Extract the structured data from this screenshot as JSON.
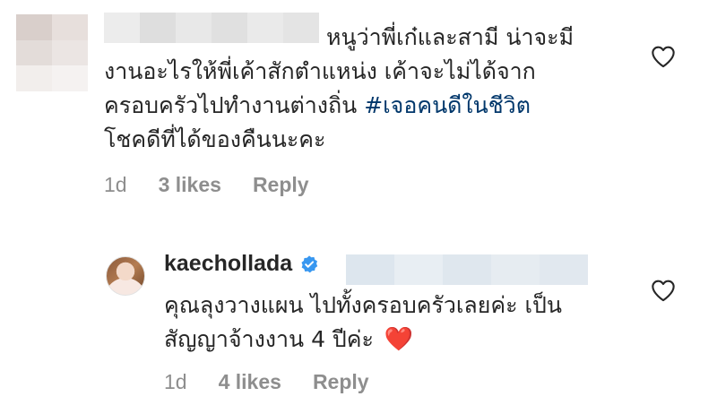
{
  "comment": {
    "line1": "หนูว่าพี่เก๋และสามี น่าจะมี",
    "line2": "งานอะไรให้พี่เค้าสักตำแหน่ง เค้าจะไม่ได้จาก",
    "line3_text": "ครอบครัวไปทำงานต่างถิ่น ",
    "hashtag": "#เจอคนดีในชีวิต",
    "line4": "โชคดีที่ได้ของคืนนะคะ",
    "time": "1d",
    "likes": "3 likes",
    "reply_label": "Reply"
  },
  "reply": {
    "username": "kaechollada",
    "line1": "คุณลุงวางแผน ไปทั้งครอบครัวเลยค่ะ เป็น",
    "line2": "สัญญาจ้างงาน 4 ปีค่ะ",
    "emoji": "❤️",
    "time": "1d",
    "likes": "4 likes",
    "reply_label": "Reply"
  },
  "icons": {
    "like": "heart-outline-icon",
    "verified": "verified-badge-icon"
  },
  "colors": {
    "text": "#262626",
    "meta": "#8e8e8e",
    "hashtag": "#00376b",
    "verified": "#3897f0",
    "heart": "#e0245e"
  }
}
